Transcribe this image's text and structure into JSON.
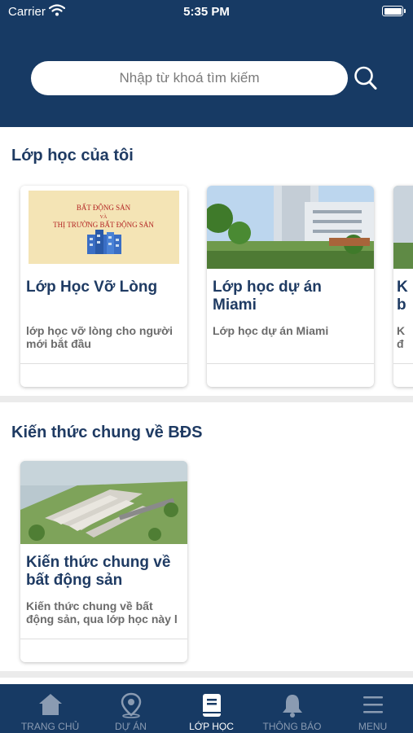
{
  "status_bar": {
    "carrier": "Carrier",
    "time": "5:35 PM"
  },
  "search": {
    "placeholder": "Nhập từ khoá tìm kiếm"
  },
  "sections": [
    {
      "title": "Lớp học của tôi",
      "cards": [
        {
          "title": "Lớp Học Vỡ Lòng",
          "description": "lớp học vỡ lòng cho người mới bắt đầu",
          "image_lines": [
            "BẤT ĐỘNG SẢN",
            "VÀ",
            "THỊ TRƯỜNG BẤT ĐỘNG SẢN"
          ]
        },
        {
          "title": "Lớp học dự án Miami",
          "description": "Lớp học dự án Miami"
        },
        {
          "title": "K b",
          "description": "K đ"
        }
      ]
    },
    {
      "title": "Kiến thức chung về BĐS",
      "cards": [
        {
          "title": "Kiến thức chung về bất động sản",
          "description": "Kiến thức chung về bất động sản, qua lớp học này l"
        }
      ]
    }
  ],
  "tabbar": {
    "items": [
      {
        "label": "TRANG CHỦ",
        "icon": "home-icon"
      },
      {
        "label": "DỰ ÁN",
        "icon": "map-pin-icon"
      },
      {
        "label": "LỚP HỌC",
        "icon": "book-icon",
        "active": true
      },
      {
        "label": "THÔNG BÁO",
        "icon": "bell-icon"
      },
      {
        "label": "MENU",
        "icon": "menu-icon"
      }
    ]
  },
  "colors": {
    "navy": "#173a64",
    "title_blue": "#1f3b63",
    "desc_gray": "#6b6b6b",
    "tab_inactive": "#8a9bb2"
  }
}
